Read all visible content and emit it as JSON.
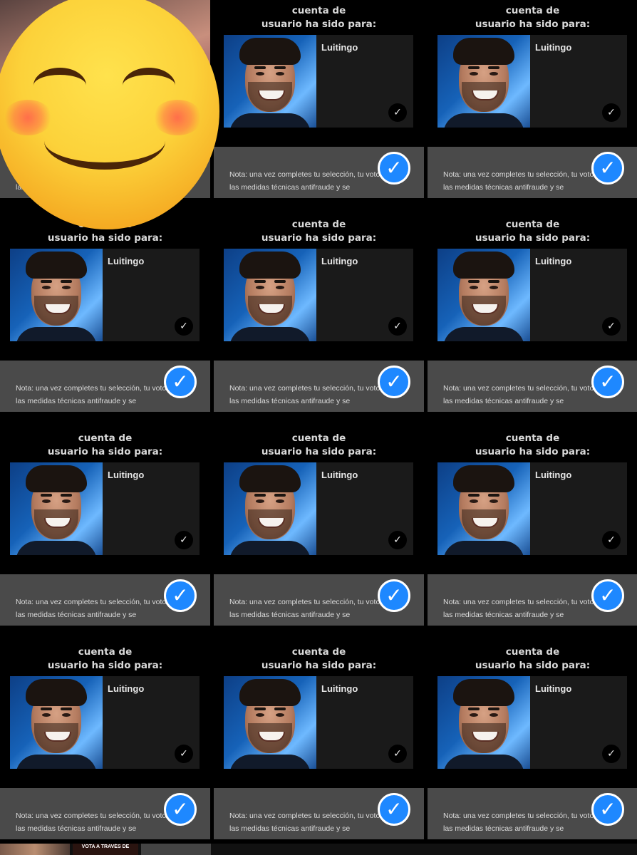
{
  "confirmation": {
    "text": "antifraude. El voto asociado a tu cuenta de\nusuario ha sido para:",
    "top_text_partial": "antifraude. El voto asociado a tu cuenta de\nusuario ha sido para:"
  },
  "candidate": {
    "name": "Luitingo"
  },
  "note": {
    "text": "Nota: una vez completes tu selección, tu voto pasará las medidas técnicas antifraude y se"
  },
  "icons": {
    "small_check": "checkmark-icon",
    "big_check": "verified-check-icon",
    "emoji": "smiling-blush-emoji"
  },
  "colors": {
    "accent": "#1e88ff",
    "note_bar": "#4a4a4a",
    "card": "#1a1a1a",
    "background": "#000000"
  },
  "bottom_strip": {
    "thumb_b_text": "VOTA A TRAVÉS DE"
  }
}
